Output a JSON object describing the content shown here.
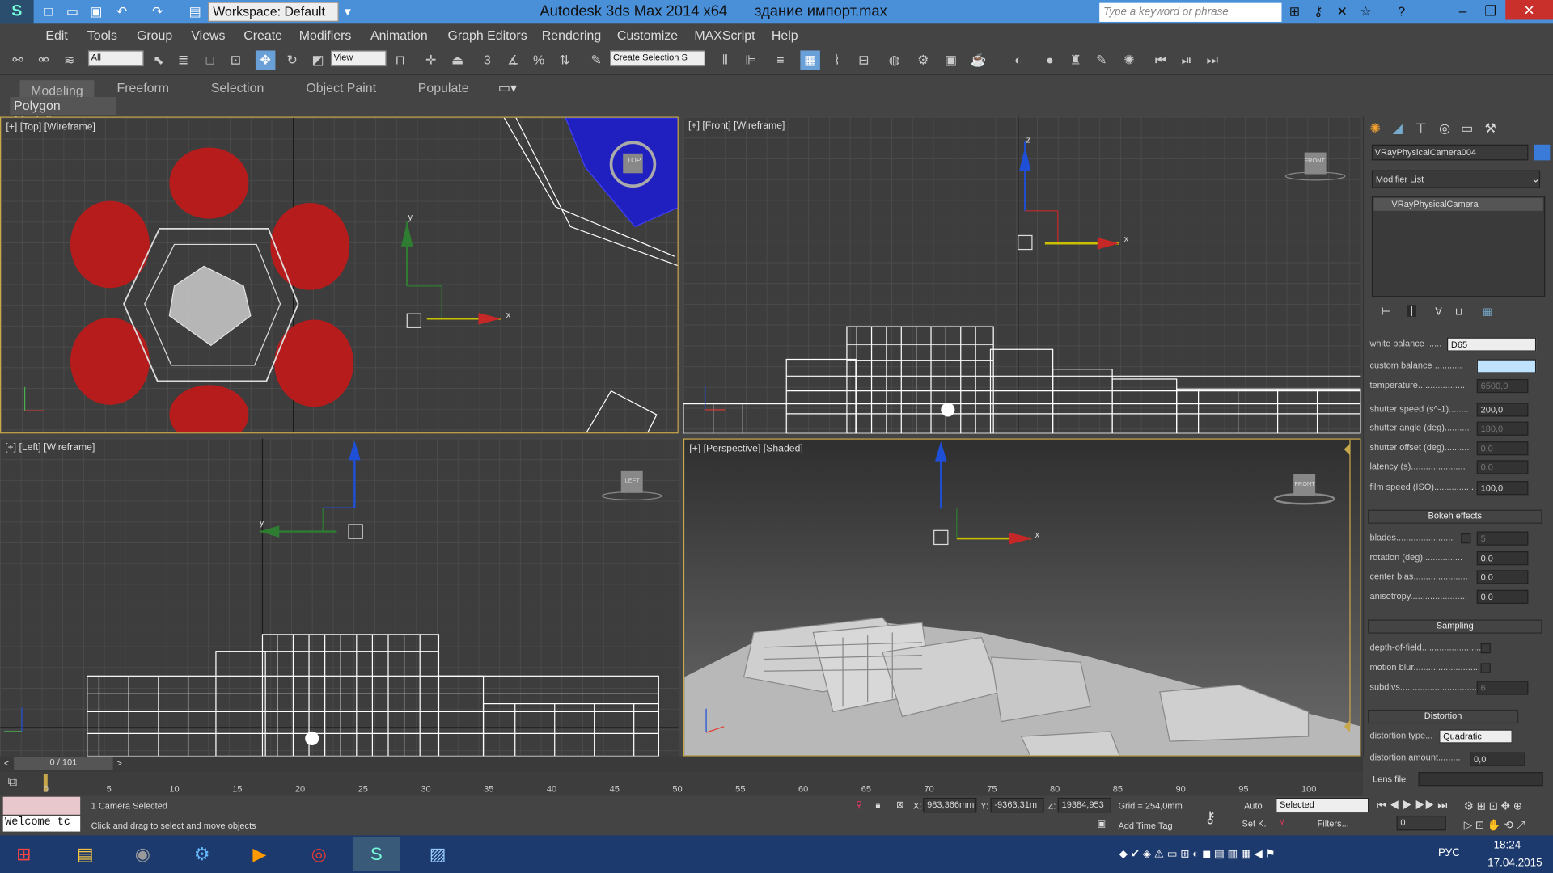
{
  "window": {
    "title": "Autodesk 3ds Max  2014 x64",
    "file": "здание импорт.max",
    "workspace": "Workspace: Default",
    "search_placeholder": "Type a keyword or phrase"
  },
  "menu": [
    "Edit",
    "Tools",
    "Group",
    "Views",
    "Create",
    "Modifiers",
    "Animation",
    "Graph Editors",
    "Rendering",
    "Customize",
    "MAXScript",
    "Help"
  ],
  "toolbar": {
    "filter": "All",
    "view": "View",
    "selection_set": "Create Selection S"
  },
  "ribbon": {
    "tabs": [
      "Modeling",
      "Freeform",
      "Selection",
      "Object Paint",
      "Populate"
    ],
    "panel": "Polygon Modeling"
  },
  "viewports": {
    "top": "[+] [Top] [Wireframe]",
    "front": "[+] [Front] [Wireframe]",
    "left": "[+] [Left] [Wireframe]",
    "persp": "[+] [Perspective] [Shaded]",
    "axis_x": "x",
    "axis_y": "y",
    "axis_z": "z",
    "cube_top": "TOP",
    "cube_front": "FRONT",
    "cube_left": "LEFT"
  },
  "command_panel": {
    "object_name": "VRayPhysicalCamera004",
    "modifier_list": "Modifier List",
    "stack_item": "VRayPhysicalCamera",
    "white_balance": {
      "label": "white balance ......",
      "value": "D65"
    },
    "params": [
      {
        "label": "custom balance ...........",
        "value": ""
      },
      {
        "label": "temperature...................",
        "value": "6500,0"
      },
      {
        "label": "shutter speed (s^-1)........",
        "value": "200,0"
      },
      {
        "label": "shutter angle (deg)..........",
        "value": "180,0"
      },
      {
        "label": "shutter offset (deg)..........",
        "value": "0,0"
      },
      {
        "label": "latency (s)......................",
        "value": "0,0"
      },
      {
        "label": "film speed (ISO).................",
        "value": "100,0"
      }
    ],
    "bokeh": {
      "title": "Bokeh effects",
      "blades_label": "blades.......................",
      "blades_value": "5",
      "rotation_label": "rotation (deg)................",
      "rotation_value": "0,0",
      "center_label": "center bias......................",
      "center_value": "0,0",
      "aniso_label": "anisotropy.......................",
      "aniso_value": "0,0"
    },
    "sampling": {
      "title": "Sampling",
      "dof": "depth-of-field.........................",
      "motion": "motion blur.............................",
      "subdivs_label": "subdivs.................................",
      "subdivs_value": "6"
    },
    "distortion": {
      "title": "Distortion",
      "type_label": "distortion type...",
      "type_value": "Quadratic",
      "amount_label": "distortion amount.........",
      "amount_value": "0,0",
      "lens": "Lens file"
    }
  },
  "timeline": {
    "frame": "0 / 101",
    "ticks": [
      "0",
      "5",
      "10",
      "15",
      "20",
      "25",
      "30",
      "35",
      "40",
      "45",
      "50",
      "55",
      "60",
      "65",
      "70",
      "75",
      "80",
      "85",
      "90",
      "95",
      "100"
    ]
  },
  "status": {
    "selected": "1 Camera Selected",
    "prompt": "Click and drag to select and move objects",
    "maxscript": "Welcome tc",
    "x_label": "X:",
    "x": "983,366mm",
    "y_label": "Y:",
    "y": "-9363,31m",
    "z_label": "Z:",
    "z": "19384,953",
    "grid": "Grid = 254,0mm",
    "auto": "Auto",
    "setk": "Set K.",
    "keymode": "Selected",
    "filters": "Filters...",
    "addtag": "Add Time Tag",
    "frame": "0"
  },
  "taskbar": {
    "lang": "РУС",
    "time": "18:24",
    "date": "17.04.2015"
  }
}
